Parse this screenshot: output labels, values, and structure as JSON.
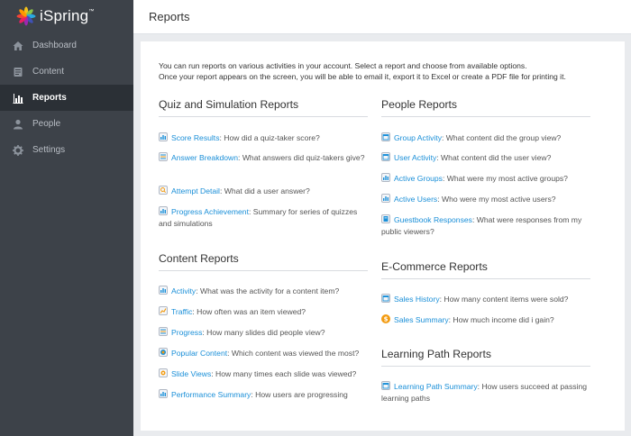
{
  "app": {
    "brand": "iSpring",
    "trademark": "™"
  },
  "sidebar": {
    "items": [
      {
        "label": "Dashboard",
        "icon": "home-icon",
        "active": false
      },
      {
        "label": "Content",
        "icon": "document-icon",
        "active": false
      },
      {
        "label": "Reports",
        "icon": "bar-chart-icon",
        "active": true
      },
      {
        "label": "People",
        "icon": "person-icon",
        "active": false
      },
      {
        "label": "Settings",
        "icon": "gear-icon",
        "active": false
      }
    ]
  },
  "header": {
    "title": "Reports"
  },
  "intro": {
    "line1": "You can run reports on various activities in your account. Select a report and choose from available options.",
    "line2": "Once your report appears on the screen, you will be able to email it, export it to Excel or create a PDF file for printing it."
  },
  "sections": {
    "quiz": {
      "title": "Quiz and Simulation Reports",
      "reports": [
        {
          "link": "Score Results",
          "desc": ": How did a quiz-taker score?",
          "icon": "bar-chart-icon"
        },
        {
          "link": "Answer Breakdown",
          "desc": ": What answers did quiz-takers give?",
          "icon": "list-icon"
        },
        {
          "link": "Attempt Detail",
          "desc": ": What did a user answer?",
          "icon": "search-doc-icon"
        },
        {
          "link": "Progress Achievement",
          "desc": ": Summary for series of quizzes and simulations",
          "icon": "bar-chart-icon"
        }
      ]
    },
    "content": {
      "title": "Content Reports",
      "reports": [
        {
          "link": "Activity",
          "desc": ": What was the activity for a content item?",
          "icon": "bar-chart-icon"
        },
        {
          "link": "Traffic",
          "desc": ": How often was an item viewed?",
          "icon": "trend-icon"
        },
        {
          "link": "Progress",
          "desc": ": How many slides did people view?",
          "icon": "list-icon"
        },
        {
          "link": "Popular Content",
          "desc": ": Which content was viewed the most?",
          "icon": "target-icon"
        },
        {
          "link": "Slide Views",
          "desc": ": How many times each slide was viewed?",
          "icon": "eye-icon"
        },
        {
          "link": "Performance Summary",
          "desc": ": How users are progressing",
          "icon": "bar-chart-icon"
        }
      ]
    },
    "people": {
      "title": "People Reports",
      "reports": [
        {
          "link": "Group Activity",
          "desc": ": What content did the group view?",
          "icon": "calendar-icon"
        },
        {
          "link": "User Activity",
          "desc": ": What content did the user view?",
          "icon": "calendar-icon"
        },
        {
          "link": "Active Groups",
          "desc": ": What were my most active groups?",
          "icon": "bar-chart-icon"
        },
        {
          "link": "Active Users",
          "desc": ": Who were my most active users?",
          "icon": "bar-chart-icon"
        },
        {
          "link": "Guestbook Responses",
          "desc": ": What were responses from my public viewers?",
          "icon": "book-icon"
        }
      ]
    },
    "ecommerce": {
      "title": "E-Commerce Reports",
      "reports": [
        {
          "link": "Sales History",
          "desc": ": How many content items were sold?",
          "icon": "calendar-icon"
        },
        {
          "link": "Sales Summary",
          "desc": ": How much income did i gain?",
          "icon": "dollar-icon"
        }
      ]
    },
    "learning": {
      "title": "Learning Path Reports",
      "reports": [
        {
          "link": "Learning Path Summary",
          "desc": ": How users succeed at passing learning paths",
          "icon": "calendar-icon"
        }
      ]
    }
  },
  "colors": {
    "sidebar_bg": "#3d4249",
    "sidebar_active_bg": "#2b3036",
    "link": "#1a8fd8",
    "page_bg": "#e9ebee"
  }
}
